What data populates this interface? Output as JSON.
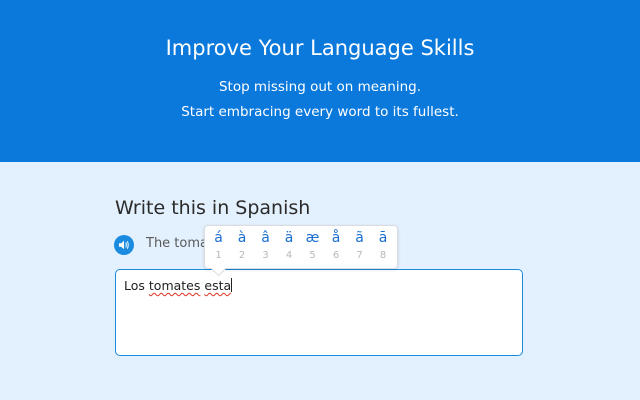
{
  "hero": {
    "title": "Improve Your Language Skills",
    "subtitle_line1": "Stop missing out on meaning.",
    "subtitle_line2": "Start embracing every word to its fullest."
  },
  "exercise": {
    "prompt": "Write this in Spanish",
    "sentence_visible": "The tomat",
    "speaker_icon": "speaker-icon",
    "answer": {
      "word1": "Los",
      "word2": "tomates",
      "word3": "esta"
    }
  },
  "accent_picker": {
    "keys": [
      {
        "char": "á",
        "num": "1"
      },
      {
        "char": "à",
        "num": "2"
      },
      {
        "char": "â",
        "num": "3"
      },
      {
        "char": "ä",
        "num": "4"
      },
      {
        "char": "æ",
        "num": "5"
      },
      {
        "char": "å",
        "num": "6"
      },
      {
        "char": "ã",
        "num": "7"
      },
      {
        "char": "ā",
        "num": "8"
      }
    ]
  },
  "colors": {
    "hero_bg": "#0a79db",
    "page_bg": "#e3f0fd",
    "accent_blue": "#1b8be0",
    "spell_error": "#e0321f"
  }
}
